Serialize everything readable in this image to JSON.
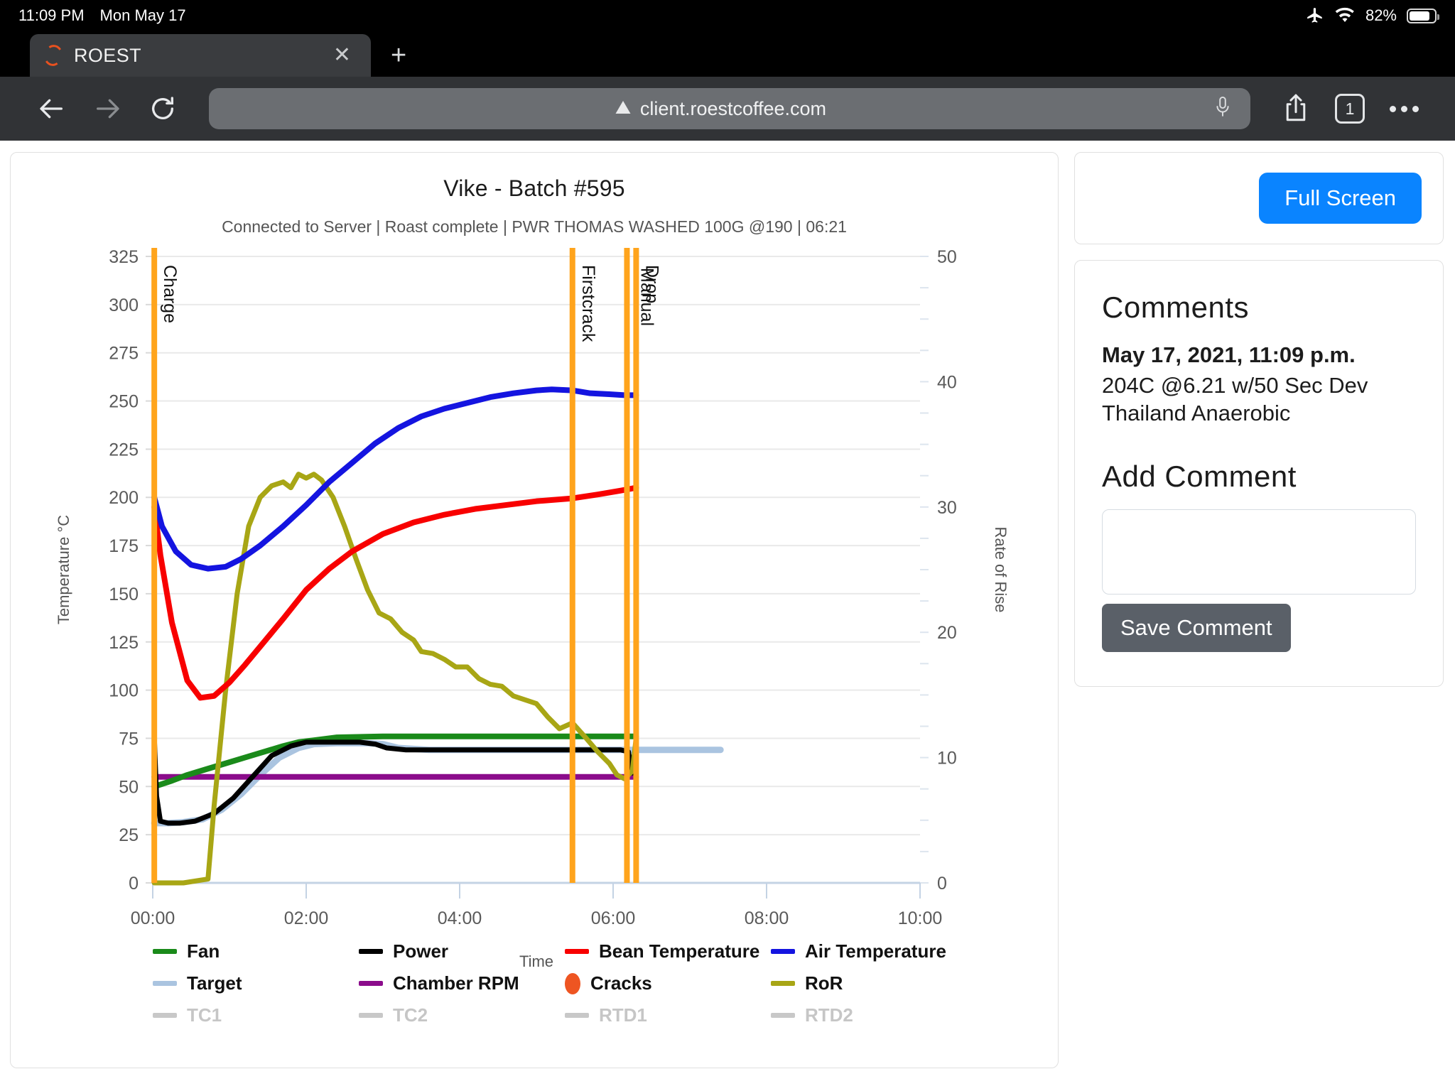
{
  "status_bar": {
    "time": "11:09 PM",
    "date": "Mon May 17",
    "battery_percent": "82%",
    "icons": [
      "airplane-mode-icon",
      "wifi-icon",
      "battery-icon"
    ]
  },
  "browser": {
    "tab_title": "ROEST",
    "tab_close_label": "✕",
    "new_tab_label": "+",
    "url": "client.roestcoffee.com",
    "tab_count": "1",
    "back_label": "←",
    "forward_label": "→",
    "reload_label": "↻"
  },
  "chart_card": {
    "title": "Vike - Batch #595",
    "subtitle": "Connected to Server | Roast complete | PWR THOMAS WASHED 100G @190 | 06:21"
  },
  "sidebar": {
    "fullscreen_label": "Full Screen",
    "comments_heading": "Comments",
    "comment_date": "May 17, 2021, 11:09 p.m.",
    "comment_text": "204C @6.21 w/50 Sec Dev Thailand Anaerobic",
    "add_comment_heading": "Add Comment",
    "comment_input_value": "",
    "save_comment_label": "Save Comment"
  },
  "chart_data": {
    "type": "line",
    "title": "Vike - Batch #595",
    "xlabel": "Time",
    "ylabel": "Temperature °C",
    "y2label": "Rate of Rise",
    "grid": true,
    "legend_position": "bottom",
    "xlim": [
      0,
      10
    ],
    "x_ticks": [
      "00:00",
      "02:00",
      "04:00",
      "06:00",
      "08:00",
      "10:00"
    ],
    "x_tick_values": [
      0,
      2,
      4,
      6,
      8,
      10
    ],
    "ylim": [
      0,
      325
    ],
    "y_ticks": [
      0,
      25,
      50,
      75,
      100,
      125,
      150,
      175,
      200,
      225,
      250,
      275,
      300,
      325
    ],
    "y2lim": [
      0,
      50
    ],
    "y2_ticks": [
      0,
      10,
      20,
      30,
      40,
      50
    ],
    "colors": {
      "fan": "#1a8a1a",
      "power": "#000000",
      "bean_temperature": "#f80000",
      "air_temperature": "#1414e0",
      "target": "#aac4e0",
      "chamber_rpm": "#8b0c8b",
      "cracks": "#ee5522",
      "ror": "#a8a615",
      "tc1": "#c8c8c8",
      "tc2": "#c8c8c8",
      "rtd1": "#c8c8c8",
      "rtd2": "#c8c8c8",
      "event_marker": "#ffa41c"
    },
    "events": [
      {
        "label": "Charge",
        "x": 0.02
      },
      {
        "label": "Firstcrack",
        "x": 5.47
      },
      {
        "label": "Drop",
        "x": 6.3
      },
      {
        "label": "Manual",
        "x": 6.18
      }
    ],
    "series": [
      {
        "name": "Fan",
        "axis": "left",
        "x": [
          0.02,
          0.1,
          0.25,
          0.45,
          0.7,
          0.95,
          1.2,
          1.45,
          1.7,
          1.9,
          2.1,
          2.4,
          3.0,
          3.6,
          4.3,
          5.0,
          5.47,
          5.9,
          6.2,
          6.3
        ],
        "values": [
          50,
          51,
          53,
          56,
          59,
          62,
          65,
          68,
          71,
          73,
          74,
          75.5,
          76,
          76,
          76,
          76,
          76,
          76,
          76,
          76
        ]
      },
      {
        "name": "Power",
        "axis": "left",
        "x": [
          0.02,
          0.05,
          0.1,
          0.2,
          0.35,
          0.55,
          0.8,
          1.05,
          1.3,
          1.55,
          1.8,
          2.0,
          2.3,
          2.7,
          2.9,
          3.05,
          3.3,
          4.0,
          4.8,
          5.47,
          5.9,
          6.1,
          6.2,
          6.25,
          6.3
        ],
        "values": [
          76,
          45,
          32,
          31,
          31,
          32,
          36,
          44,
          55,
          66,
          71,
          73,
          73,
          73,
          72,
          70,
          69,
          69,
          69,
          69,
          69,
          69,
          68,
          57,
          57
        ]
      },
      {
        "name": "Target",
        "axis": "left",
        "x": [
          0.02,
          0.2,
          0.4,
          0.65,
          0.9,
          1.15,
          1.4,
          1.65,
          1.9,
          2.1,
          2.4,
          2.8,
          3.0,
          3.2,
          3.6,
          4.4,
          5.2,
          5.9,
          6.3,
          7.0,
          7.4
        ],
        "values": [
          31,
          31,
          31.5,
          33,
          38,
          46,
          56,
          65,
          70,
          72,
          72.5,
          72.5,
          72,
          70,
          69,
          69,
          69,
          69,
          69,
          69,
          69
        ]
      },
      {
        "name": "Chamber RPM",
        "axis": "left",
        "x": [
          0.02,
          1.0,
          2.0,
          3.0,
          4.0,
          5.0,
          6.0,
          6.3
        ],
        "values": [
          55,
          55,
          55,
          55,
          55,
          55,
          55,
          55
        ]
      },
      {
        "name": "Bean Temperature",
        "axis": "left",
        "x": [
          0.02,
          0.1,
          0.25,
          0.45,
          0.62,
          0.8,
          1.0,
          1.2,
          1.45,
          1.7,
          2.0,
          2.3,
          2.6,
          3.0,
          3.4,
          3.8,
          4.2,
          4.6,
          5.0,
          5.47,
          5.8,
          6.1,
          6.3
        ],
        "values": [
          195,
          170,
          135,
          105,
          96,
          97,
          104,
          113,
          125,
          137,
          152,
          163,
          172,
          181,
          187,
          191,
          194,
          196,
          198,
          199.5,
          201.5,
          203.5,
          205
        ]
      },
      {
        "name": "Air Temperature",
        "axis": "left",
        "x": [
          0.02,
          0.12,
          0.3,
          0.5,
          0.72,
          0.95,
          1.15,
          1.4,
          1.7,
          2.0,
          2.3,
          2.6,
          2.9,
          3.2,
          3.5,
          3.8,
          4.1,
          4.4,
          4.7,
          5.0,
          5.2,
          5.47,
          5.7,
          5.95,
          6.15,
          6.3
        ],
        "values": [
          200,
          185,
          172,
          165,
          163,
          164,
          168,
          175,
          185,
          196,
          208,
          218,
          228,
          236,
          242,
          246,
          249,
          252,
          254,
          255.5,
          256,
          255.5,
          254,
          253.5,
          253,
          253
        ]
      },
      {
        "name": "RoR",
        "axis": "right",
        "x": [
          0.02,
          0.4,
          0.72,
          0.8,
          0.95,
          1.1,
          1.25,
          1.4,
          1.55,
          1.7,
          1.8,
          1.9,
          2.0,
          2.1,
          2.2,
          2.35,
          2.5,
          2.65,
          2.8,
          2.95,
          3.1,
          3.25,
          3.4,
          3.5,
          3.65,
          3.8,
          3.95,
          4.1,
          4.25,
          4.4,
          4.55,
          4.7,
          4.85,
          5.0,
          5.15,
          5.3,
          5.47,
          5.65,
          5.8,
          5.95,
          6.05,
          6.15,
          6.25,
          6.3
        ],
        "values_temp_scale": [
          0,
          0,
          2,
          40,
          100,
          150,
          185,
          200,
          206,
          208,
          205,
          212,
          210,
          212,
          209,
          200,
          185,
          168,
          152,
          140,
          137,
          130,
          126,
          120,
          119,
          116,
          112,
          112,
          106,
          103,
          102,
          97,
          95,
          93,
          86,
          80,
          83,
          75,
          68,
          62,
          56,
          54,
          58,
          75
        ],
        "note": "values plotted on right Rate-of-Rise axis; listed in left-temperature pixel scale equivalent"
      }
    ],
    "legend": [
      {
        "label": "Fan",
        "color": "#1a8a1a",
        "marker": "line",
        "muted": false
      },
      {
        "label": "Power",
        "color": "#000000",
        "marker": "line",
        "muted": false
      },
      {
        "label": "Bean Temperature",
        "color": "#f80000",
        "marker": "line",
        "muted": false
      },
      {
        "label": "Air Temperature",
        "color": "#1414e0",
        "marker": "line",
        "muted": false
      },
      {
        "label": "Target",
        "color": "#aac4e0",
        "marker": "line",
        "muted": false
      },
      {
        "label": "Chamber RPM",
        "color": "#8b0c8b",
        "marker": "line",
        "muted": false
      },
      {
        "label": "Cracks",
        "color": "#ee5522",
        "marker": "dot",
        "muted": false
      },
      {
        "label": "RoR",
        "color": "#a8a615",
        "marker": "line",
        "muted": false
      },
      {
        "label": "TC1",
        "color": "#c8c8c8",
        "marker": "line",
        "muted": true
      },
      {
        "label": "TC2",
        "color": "#c8c8c8",
        "marker": "line",
        "muted": true
      },
      {
        "label": "RTD1",
        "color": "#c8c8c8",
        "marker": "line",
        "muted": true
      },
      {
        "label": "RTD2",
        "color": "#c8c8c8",
        "marker": "line",
        "muted": true
      }
    ]
  }
}
